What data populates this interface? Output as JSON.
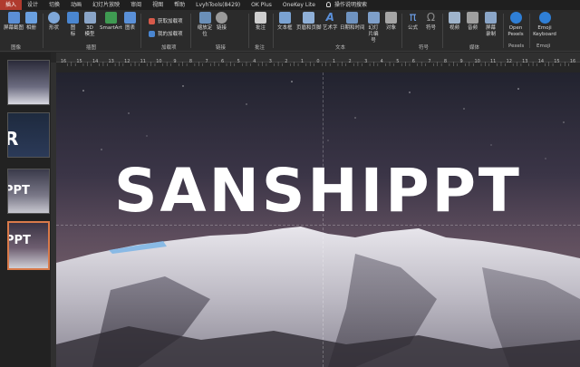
{
  "menu": {
    "tabs": [
      "插入",
      "设计",
      "切换",
      "动画",
      "幻灯片放映",
      "审阅",
      "视图",
      "帮助",
      "LvyhTools(8429)",
      "OK Plus",
      "OneKey Lite",
      "操作说明搜索"
    ],
    "active_tab": "插入"
  },
  "ribbon": {
    "buttons": {
      "screenshot": "屏幕截图",
      "album": "相册",
      "shapes": "形状",
      "icons": "图标",
      "model3d": "3D 模型",
      "smartart": "SmartArt",
      "chart": "图表",
      "zoom": "缩放定位",
      "link": "链接",
      "comment": "批注",
      "textbox": "文本框",
      "header_footer": "页眉和页脚",
      "wordart": "艺术字",
      "datetime": "日期和时间",
      "slide_number": "幻灯片编号",
      "object": "对象",
      "equation": "公式",
      "symbol": "符号",
      "video": "视频",
      "audio": "音频",
      "screen_record": "屏幕录制",
      "open_pexels": "Open Pexels",
      "emoji_keyboard": "Emoji Keyboard"
    },
    "small_buttons": {
      "get_addins": "获取加载项",
      "my_addins": "我的加载项"
    },
    "groups": {
      "images": "图像",
      "illustrations": "插图",
      "addins": "加载项",
      "links": "链接",
      "comments": "批注",
      "text": "文本",
      "symbols": "符号",
      "media": "媒体",
      "pexels": "Pexels",
      "emoji": "Emoji"
    }
  },
  "thumbnails": [
    {
      "text": "",
      "selected": false
    },
    {
      "text": "R",
      "selected": false
    },
    {
      "text": "PPT",
      "selected": false
    },
    {
      "text": "PPT",
      "selected": true
    }
  ],
  "ruler": {
    "labels": [
      "16",
      "15",
      "14",
      "13",
      "12",
      "11",
      "10",
      "9",
      "8",
      "7",
      "6",
      "5",
      "4",
      "3",
      "2",
      "1",
      "0",
      "1",
      "2",
      "3",
      "4",
      "5",
      "6",
      "7",
      "8",
      "9",
      "10",
      "11",
      "12",
      "13",
      "14",
      "15",
      "16"
    ]
  },
  "slide": {
    "title": "SANSHIPPT"
  }
}
